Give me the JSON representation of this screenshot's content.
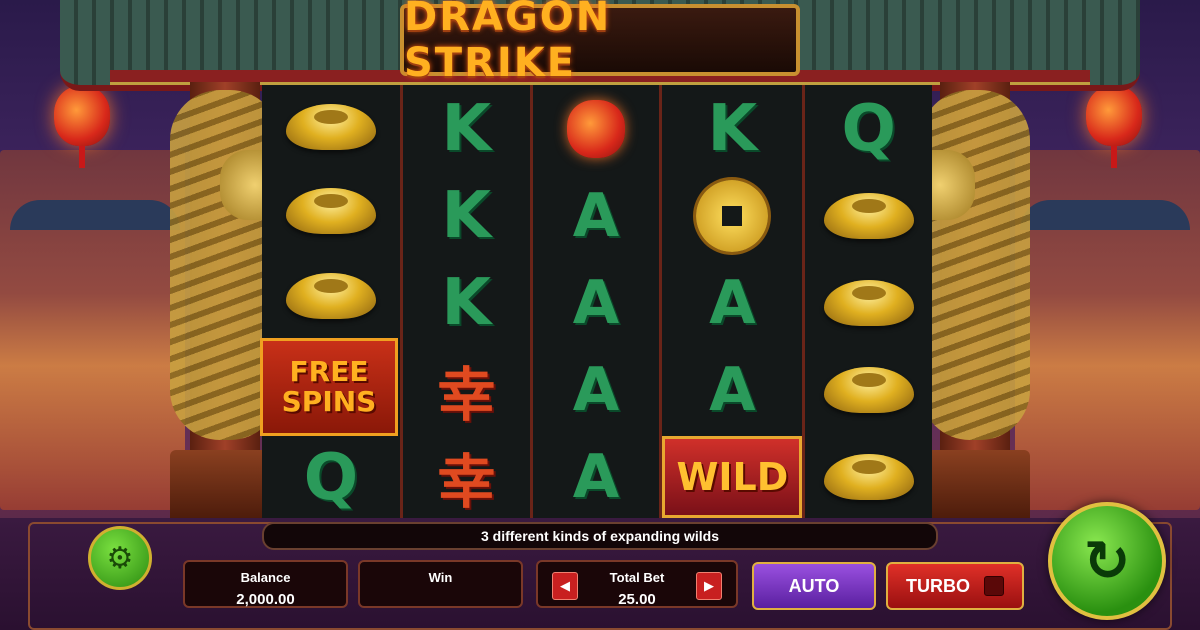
{
  "game": {
    "title": "DRAGON STRIKE"
  },
  "reels": [
    [
      "ingot",
      "ingot",
      "ingot",
      "free_spins",
      "Q"
    ],
    [
      "K",
      "K",
      "K",
      "char",
      "char"
    ],
    [
      "lantern",
      "A",
      "A",
      "A",
      "A"
    ],
    [
      "K",
      "coin",
      "A",
      "A",
      "wild"
    ],
    [
      "Q",
      "ingot",
      "ingot",
      "ingot",
      "ingot"
    ]
  ],
  "symbols": {
    "free_spins_line1": "FREE",
    "free_spins_line2": "SPINS",
    "wild": "WILD",
    "char": "幸"
  },
  "info": {
    "message": "3 different kinds of expanding wilds"
  },
  "panels": {
    "balance_label": "Balance",
    "balance_value": "2,000.00",
    "win_label": "Win",
    "win_value": "",
    "totalbet_label": "Total Bet",
    "totalbet_value": "25.00"
  },
  "buttons": {
    "auto": "AUTO",
    "turbo": "TURBO",
    "bet_dec": "◀",
    "bet_inc": "▶",
    "settings_icon": "gear-icon",
    "spin_icon": "spin-arrow-icon"
  },
  "colors": {
    "spin_button": "#3aa018",
    "auto_button": "#7a38c8",
    "turbo_button": "#c82020",
    "title": "#ffb020"
  }
}
